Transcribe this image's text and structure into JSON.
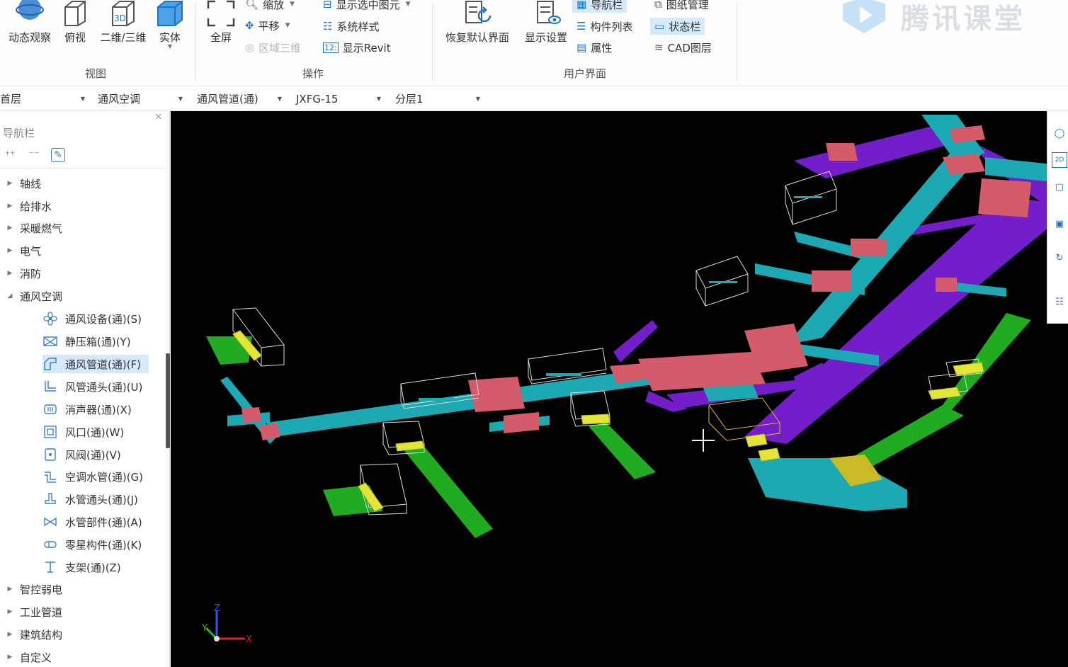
{
  "ribbon": {
    "view_group": {
      "label": "视图",
      "buttons": [
        {
          "label": "动态观察",
          "icon": "orbit-icon"
        },
        {
          "label": "俯视",
          "icon": "top-view-icon"
        },
        {
          "label": "二维/三维",
          "icon": "3d-icon",
          "badge": "3D"
        },
        {
          "label": "实体",
          "icon": "solid-icon"
        }
      ]
    },
    "operate_group": {
      "label": "操作",
      "fullscreen": "全屏",
      "zoom": "缩放",
      "pan": "平移",
      "region_3d": "区域三维",
      "show_selected": "显示选中图元",
      "system_style": "系统样式",
      "show_revit": "显示Revit"
    },
    "ui_group": {
      "label": "用户界面",
      "restore_default": "恢复默认界面",
      "display_settings": "显示设置",
      "nav_bar": "导航栏",
      "component_list": "构件列表",
      "properties": "属性",
      "drawing_mgmt": "图纸管理",
      "status_bar": "状态栏",
      "cad_layer": "CAD图层"
    },
    "logo_text": "腾讯课堂"
  },
  "filters": {
    "floor": "首层",
    "discipline": "通风空调",
    "component_type": "通风管道(通)",
    "component": "JXFG-15",
    "layer": "分层1"
  },
  "nav": {
    "title": "导航栏",
    "close": "×",
    "categories_top": [
      "轴线",
      "给排水",
      "采暖燃气",
      "电气",
      "消防"
    ],
    "expanded": "通风空调",
    "subitems": [
      {
        "label": "通风设备(通)(S)",
        "icon": "fan-icon"
      },
      {
        "label": "静压箱(通)(Y)",
        "icon": "plenum-box-icon"
      },
      {
        "label": "通风管道(通)(F)",
        "icon": "duct-icon",
        "selected": true
      },
      {
        "label": "风管通头(通)(U)",
        "icon": "duct-fitting-icon"
      },
      {
        "label": "消声器(通)(X)",
        "icon": "silencer-icon"
      },
      {
        "label": "风口(通)(W)",
        "icon": "air-outlet-icon"
      },
      {
        "label": "风阀(通)(V)",
        "icon": "damper-icon"
      },
      {
        "label": "空调水管(通)(G)",
        "icon": "water-pipe-icon"
      },
      {
        "label": "水管通头(通)(J)",
        "icon": "pipe-fitting-icon"
      },
      {
        "label": "水管部件(通)(A)",
        "icon": "valve-icon"
      },
      {
        "label": "零星构件(通)(K)",
        "icon": "misc-component-icon"
      },
      {
        "label": "支架(通)(Z)",
        "icon": "support-icon"
      }
    ],
    "categories_bottom": [
      "智控弱电",
      "工业管道",
      "建筑结构",
      "自定义"
    ]
  },
  "axes": {
    "x": "X",
    "y": "Y",
    "z": "Z"
  },
  "right_tools": {
    "view_2d": "2D"
  },
  "colors": {
    "duct_cyan": "#1fb3bd",
    "duct_purple": "#7a1fd6",
    "duct_green": "#22b522",
    "fitting_red": "#e06070",
    "equipment_yellow": "#f2f23a",
    "viewport_bg": "#000000",
    "highlight": "#d6e8fb"
  }
}
